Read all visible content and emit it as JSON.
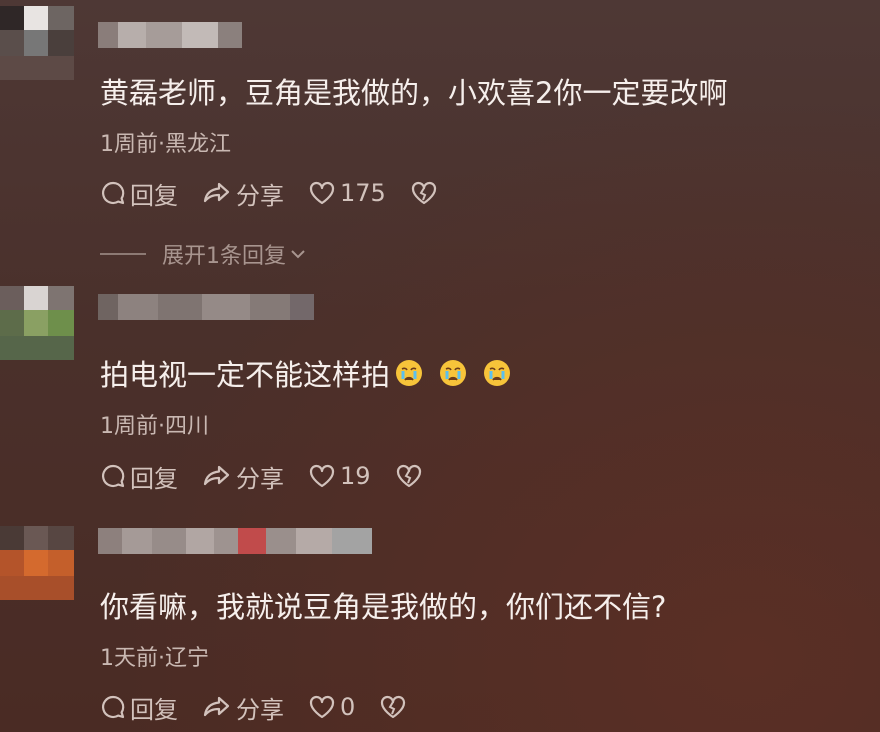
{
  "comments": [
    {
      "text": "黄磊老师，豆角是我做的，小欢喜2你一定要改啊",
      "meta": "1周前·黑龙江",
      "reply_label": "回复",
      "share_label": "分享",
      "like_count": "175",
      "expand_label": "展开1条回复"
    },
    {
      "text": "拍电视一定不能这样拍",
      "meta": "1周前·四川",
      "reply_label": "回复",
      "share_label": "分享",
      "like_count": "19",
      "emojis": [
        "crying-face",
        "crying-face",
        "crying-face"
      ]
    },
    {
      "text": "你看嘛，我就说豆角是我做的，你们还不信?",
      "meta": "1天前·辽宁",
      "reply_label": "回复",
      "share_label": "分享",
      "like_count": "0"
    }
  ],
  "icons": {
    "reply": "comment-bubble-icon",
    "share": "share-arrow-icon",
    "like": "heart-icon",
    "dislike": "broken-heart-icon",
    "expand": "chevron-down-icon"
  }
}
